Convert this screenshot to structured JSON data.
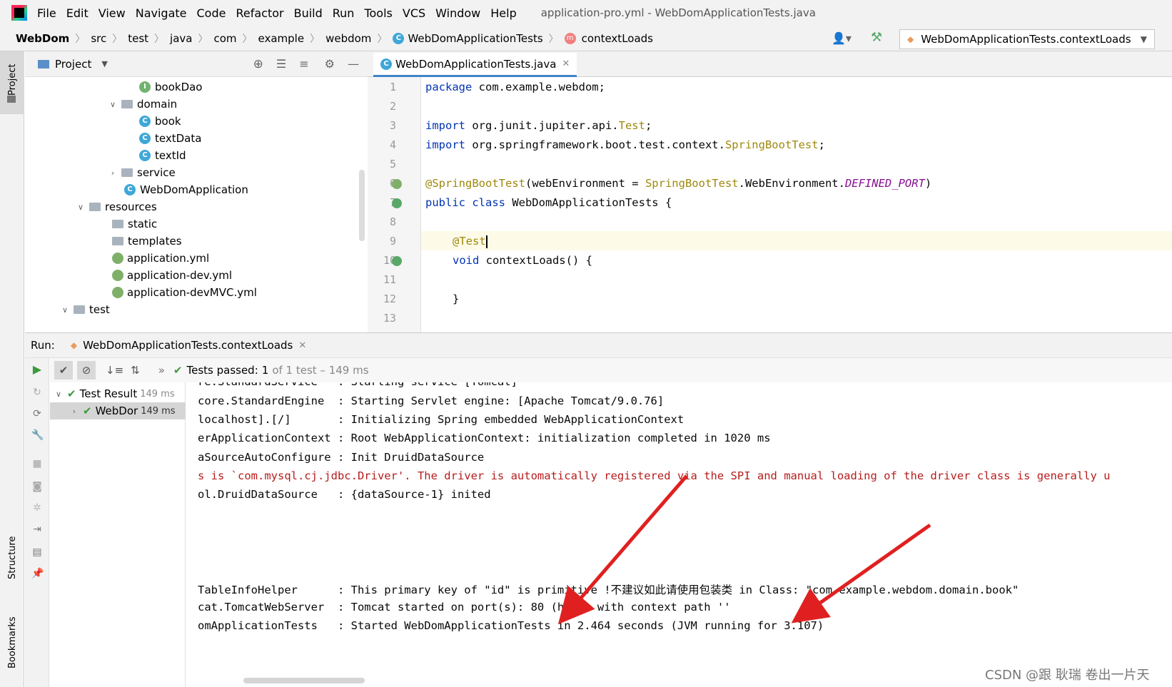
{
  "menu": {
    "items": [
      "File",
      "Edit",
      "View",
      "Navigate",
      "Code",
      "Refactor",
      "Build",
      "Run",
      "Tools",
      "VCS",
      "Window",
      "Help"
    ],
    "window_title": "application-pro.yml - WebDomApplicationTests.java"
  },
  "breadcrumb": {
    "items": [
      "WebDom",
      "src",
      "test",
      "java",
      "com",
      "example",
      "webdom",
      "WebDomApplicationTests",
      "contextLoads"
    ]
  },
  "run_config": {
    "label": "WebDomApplicationTests.contextLoads"
  },
  "left_stripe": {
    "project": "Project",
    "structure": "Structure",
    "bookmarks": "Bookmarks"
  },
  "project_panel": {
    "title": "Project",
    "tree": [
      {
        "label": "bookDao",
        "kind": "interface",
        "toggle": ""
      },
      {
        "label": "domain",
        "kind": "folder",
        "toggle": "v"
      },
      {
        "label": "book",
        "kind": "class",
        "toggle": ""
      },
      {
        "label": "textData",
        "kind": "class",
        "toggle": ""
      },
      {
        "label": "textId",
        "kind": "class",
        "toggle": ""
      },
      {
        "label": "service",
        "kind": "folder",
        "toggle": ">"
      },
      {
        "label": "WebDomApplication",
        "kind": "class",
        "toggle": ""
      },
      {
        "label": "resources",
        "kind": "folder",
        "toggle": "v"
      },
      {
        "label": "static",
        "kind": "folder",
        "toggle": ""
      },
      {
        "label": "templates",
        "kind": "folder",
        "toggle": ""
      },
      {
        "label": "application.yml",
        "kind": "yml",
        "toggle": ""
      },
      {
        "label": "application-dev.yml",
        "kind": "yml",
        "toggle": ""
      },
      {
        "label": "application-devMVC.yml",
        "kind": "yml",
        "toggle": ""
      },
      {
        "label": "test",
        "kind": "folder",
        "toggle": "v"
      }
    ]
  },
  "editor": {
    "tab_label": "WebDomApplicationTests.java",
    "line_numbers": [
      "1",
      "2",
      "3",
      "4",
      "5",
      "6",
      "7",
      "8",
      "9",
      "10",
      "11",
      "12",
      "13"
    ],
    "code": {
      "l1_kw": "package",
      "l1_rest": " com.example.webdom;",
      "l3_kw": "import",
      "l3_rest": " org.junit.jupiter.api.",
      "l3_ref": "Test",
      "l3_end": ";",
      "l4_kw": "import",
      "l4_rest": " org.springframework.boot.test.context.",
      "l4_ref": "SpringBootTest",
      "l4_end": ";",
      "l6_ann": "@SpringBootTest",
      "l6_a": "(webEnvironment = ",
      "l6_ref": "SpringBootTest",
      "l6_b": ".WebEnvironment.",
      "l6_cst": "DEFINED_PORT",
      "l6_end": ")",
      "l7_kw": "public class",
      "l7_rest": " WebDomApplicationTests {",
      "l9_ann": "@Test",
      "l10_kw": "void",
      "l10_rest": " contextLoads() {",
      "l12": "}"
    }
  },
  "run_panel": {
    "label": "Run:",
    "tab_label": "WebDomApplicationTests.contextLoads",
    "status_prefix": "Tests passed:",
    "status_count": "1",
    "status_rest": "of 1 test – 149 ms",
    "test_tree": [
      {
        "label": "Test Result",
        "time": "149 ms"
      },
      {
        "label": "WebDor",
        "time": "149 ms"
      }
    ],
    "console": [
      {
        "text": "re.StandardService   : Starting service [Tomcat]",
        "level": "info"
      },
      {
        "text": "core.StandardEngine  : Starting Servlet engine: [Apache Tomcat/9.0.76]",
        "level": "info"
      },
      {
        "text": "localhost].[/]       : Initializing Spring embedded WebApplicationContext",
        "level": "info"
      },
      {
        "text": "erApplicationContext : Root WebApplicationContext: initialization completed in 1020 ms",
        "level": "info"
      },
      {
        "text": "aSourceAutoConfigure : Init DruidDataSource",
        "level": "info"
      },
      {
        "text": "s is `com.mysql.cj.jdbc.Driver'. The driver is automatically registered via the SPI and manual loading of the driver class is generally u",
        "level": "err"
      },
      {
        "text": "ol.DruidDataSource   : {dataSource-1} inited",
        "level": "info"
      },
      {
        "text": "",
        "level": "info"
      },
      {
        "text": "",
        "level": "info"
      },
      {
        "text": "",
        "level": "info"
      },
      {
        "text": "",
        "level": "info"
      },
      {
        "text": "TableInfoHelper      : This primary key of \"id\" is primitive !不建议如此请使用包装类 in Class: \"com.example.webdom.domain.book\"",
        "level": "info"
      },
      {
        "text": "cat.TomcatWebServer  : Tomcat started on port(s): 80 (http) with context path ''",
        "level": "info"
      },
      {
        "text": "omApplicationTests   : Started WebDomApplicationTests in 2.464 seconds (JVM running for 3.107)",
        "level": "info"
      }
    ]
  },
  "watermark": "CSDN @跟 耿瑞 卷出一片天",
  "colors": {
    "accent": "#4083c9",
    "arrow": "#e02020",
    "pass": "#3d9a3d",
    "error_text": "#b71c1c"
  }
}
